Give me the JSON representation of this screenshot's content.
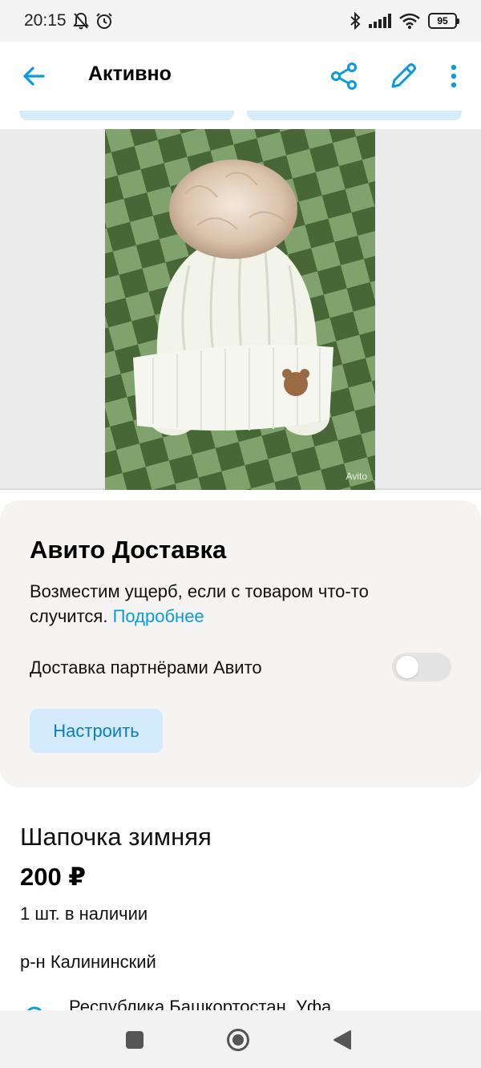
{
  "status_bar": {
    "time": "20:15",
    "battery": "95",
    "icons": [
      "bell-off-icon",
      "alarm-icon",
      "bluetooth-icon",
      "signal-icon",
      "wifi-icon",
      "battery-icon"
    ]
  },
  "app_bar": {
    "title": "Активно",
    "icons": [
      "back-arrow-icon",
      "share-icon",
      "pencil-icon",
      "more-vertical-icon"
    ]
  },
  "photo": {
    "watermark": "Avito"
  },
  "delivery": {
    "title": "Авито Доставка",
    "description": "Возместим ущерб, если с товаром что-то случится.",
    "more_link": "Подробнее",
    "partner_label": "Доставка партнёрами Авито",
    "partner_enabled": false,
    "configure_label": "Настроить"
  },
  "item": {
    "title": "Шапочка зимняя",
    "price": "200 ₽",
    "stock": "1 шт. в наличии",
    "district": "р-н Калининский",
    "address": "Республика Башкортостан, Уфа"
  },
  "colors": {
    "accent": "#0a9ae0",
    "button_bg": "#d3ebfb",
    "card_bg": "#f5f4f2"
  }
}
